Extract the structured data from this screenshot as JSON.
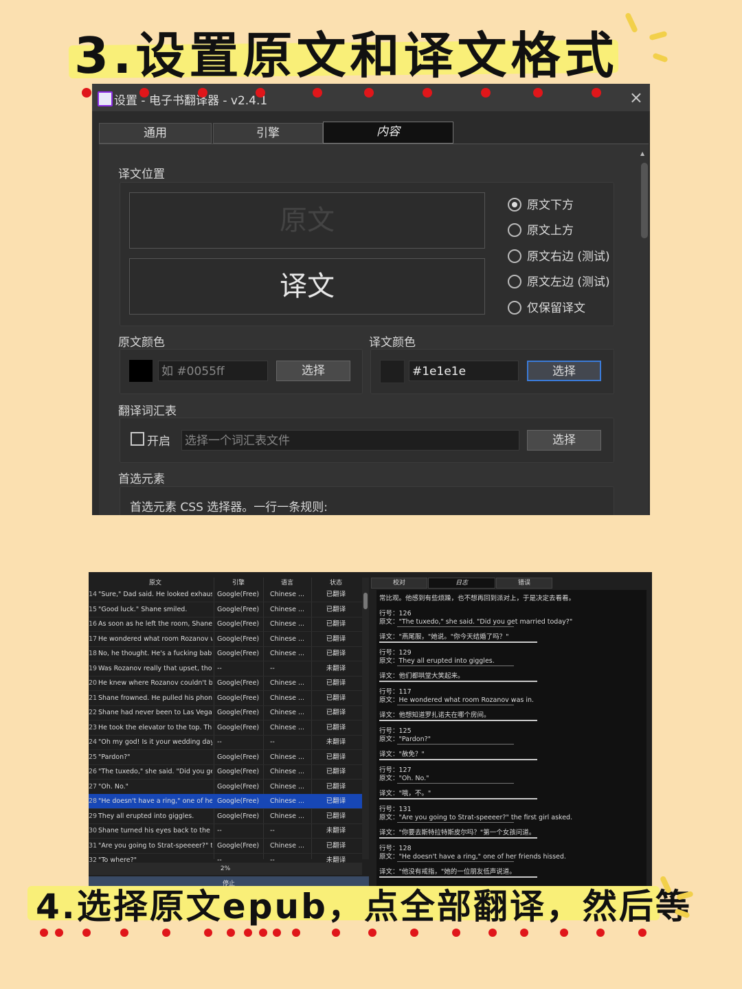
{
  "heading_top": "3.设置原文和译文格式",
  "settings_window": {
    "title": "设置 - 电子书翻译器 - v2.4.1",
    "close": "×",
    "tabs": [
      "通用",
      "引擎",
      "内容"
    ],
    "position_section": {
      "label": "译文位置",
      "preview_original": "原文",
      "preview_translation": "译文",
      "options": [
        "原文下方",
        "原文上方",
        "原文右边 (测试)",
        "原文左边 (测试)",
        "仅保留译文"
      ],
      "selected_index": 0
    },
    "original_color": {
      "label": "原文颜色",
      "swatch": "#000000",
      "placeholder": "如 #0055ff",
      "button": "选择"
    },
    "translation_color": {
      "label": "译文颜色",
      "swatch": "#1e1e1e",
      "value": "#1e1e1e",
      "button": "选择"
    },
    "glossary": {
      "label": "翻译词汇表",
      "checkbox_label": "开启",
      "checked": false,
      "placeholder": "选择一个词汇表文件",
      "button": "选择"
    },
    "preferred": {
      "label": "首选元素",
      "desc": "首选元素 CSS 选择器。一行一条规则:"
    }
  },
  "job_window": {
    "columns": [
      "原文",
      "引擎",
      "语言",
      "状态"
    ],
    "rows": [
      {
        "n": "14",
        "src": "\"Sure,\" Dad said. He looked exhausted...",
        "eng": "Google(Free)...",
        "lang": "Chinese ...",
        "st": "已翻译"
      },
      {
        "n": "15",
        "src": "\"Good luck.\" Shane smiled.",
        "eng": "Google(Free)...",
        "lang": "Chinese ...",
        "st": "已翻译"
      },
      {
        "n": "16",
        "src": "As soon as he left the room, Shane fel...",
        "eng": "Google(Free)...",
        "lang": "Chinese ...",
        "st": "已翻译"
      },
      {
        "n": "17",
        "src": "He wondered what room Rozanov wa...",
        "eng": "Google(Free)...",
        "lang": "Chinese ...",
        "st": "已翻译"
      },
      {
        "n": "18",
        "src": "No, he thought. He's a fucking baby ...",
        "eng": "Google(Free)...",
        "lang": "Chinese ...",
        "st": "已翻译"
      },
      {
        "n": "19",
        "src": "Was Rozanov really that upset, thoug...",
        "eng": "--",
        "lang": "--",
        "st": "未翻译"
      },
      {
        "n": "20",
        "src": "He knew where Rozanov couldn't be ...",
        "eng": "Google(Free)...",
        "lang": "Chinese ...",
        "st": "已翻译"
      },
      {
        "n": "21",
        "src": "Shane frowned. He pulled his phone ...",
        "eng": "Google(Free)...",
        "lang": "Chinese ...",
        "st": "已翻译"
      },
      {
        "n": "22",
        "src": "Shane had never been to Las Vegas ...",
        "eng": "Google(Free)...",
        "lang": "Chinese ...",
        "st": "已翻译"
      },
      {
        "n": "23",
        "src": "He took the elevator to the top. There...",
        "eng": "Google(Free)...",
        "lang": "Chinese ...",
        "st": "已翻译"
      },
      {
        "n": "24",
        "src": "\"Oh my god! Is it your wedding day?\" ...",
        "eng": "--",
        "lang": "--",
        "st": "未翻译"
      },
      {
        "n": "25",
        "src": "\"Pardon?\"",
        "eng": "Google(Free)...",
        "lang": "Chinese ...",
        "st": "已翻译"
      },
      {
        "n": "26",
        "src": "\"The tuxedo,\" she said. \"Did you get ...",
        "eng": "Google(Free)...",
        "lang": "Chinese ...",
        "st": "已翻译"
      },
      {
        "n": "27",
        "src": "\"Oh. No.\"",
        "eng": "Google(Free)...",
        "lang": "Chinese ...",
        "st": "已翻译"
      },
      {
        "n": "28",
        "src": "\"He doesn't have a ring,\" one of her ...",
        "eng": "Google(Free)...",
        "lang": "Chinese ...",
        "st": "已翻译"
      },
      {
        "n": "29",
        "src": "They all erupted into giggles.",
        "eng": "Google(Free)...",
        "lang": "Chinese ...",
        "st": "已翻译"
      },
      {
        "n": "30",
        "src": "Shane turned his eyes back to the ...",
        "eng": "--",
        "lang": "--",
        "st": "未翻译"
      },
      {
        "n": "31",
        "src": "\"Are you going to Strat-speeeer?\" the ...",
        "eng": "Google(Free)...",
        "lang": "Chinese ...",
        "st": "已翻译"
      },
      {
        "n": "32",
        "src": "\"To where?\"",
        "eng": "--",
        "lang": "--",
        "st": "未翻译"
      }
    ],
    "selected_row": 14,
    "progress": "2%",
    "stop_button": "停止",
    "log_tabs": [
      "校对",
      "日志",
      "错误"
    ],
    "log_head": "常比观。他感到有些烦躁，也不想再回到派对上，于是决定去看看。",
    "log_entries": [
      {
        "line": "行号：126",
        "orig": "原文：\"The tuxedo,\" she said. \"Did you get married today?\"",
        "trans": "译文：\"燕尾服，\"她说。\"你今天结婚了吗？\""
      },
      {
        "line": "行号：129",
        "orig": "原文：They all erupted into giggles.",
        "trans": "译文：他们都哄堂大笑起来。"
      },
      {
        "line": "行号：117",
        "orig": "原文：He wondered what room Rozanov was in.",
        "trans": "译文：他想知道罗扎诺夫在哪个房间。"
      },
      {
        "line": "行号：125",
        "orig": "原文：\"Pardon?\"",
        "trans": "译文：\"赦免？\""
      },
      {
        "line": "行号：127",
        "orig": "原文：\"Oh. No.\"",
        "trans": "译文：\"哦，不。\""
      },
      {
        "line": "行号：131",
        "orig": "原文：\"Are you going to Strat-speeeer?\" the first girl asked.",
        "trans": "译文：\"你要去斯特拉特斯皮尔吗？\"第一个女孩问道。"
      },
      {
        "line": "行号：128",
        "orig": "原文：\"He doesn't have a ring,\" one of her friends hissed.",
        "trans": "译文：\"他没有戒指，\"她的一位朋友低声说道。"
      }
    ]
  },
  "heading_bottom": "4.选择原文epub，点全部翻译，然后等"
}
